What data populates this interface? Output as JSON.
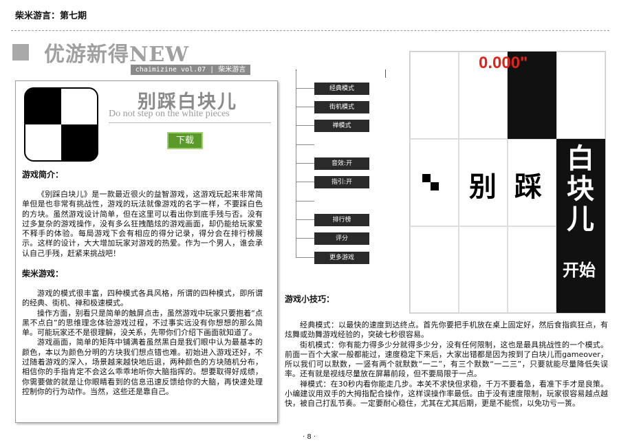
{
  "header": {
    "title": "柴米游言：第七期"
  },
  "section": {
    "title": "优游新得NEW",
    "tag": "chaimizine vol.07 | 柴米游言"
  },
  "game": {
    "name": "别踩白块儿",
    "name_en": "Do not step on the white pieces",
    "download_label": "下载"
  },
  "intro": {
    "heading": "游戏简介：",
    "paragraphs": [
      "《别踩白块儿》是一款最近很火的益智游戏，这游戏玩起来非常简单但是也非常有挑战性，游戏的玩法就像游戏的名字一样，不要踩白色的方块。虽然游戏设计简单，但在这里可以看出你到底手残与否。没有过多复杂的游戏操作，没有多么狂拽酷炫的游戏画面，却仍能给玩家爱不释手的体验。每局游戏下会有相应的得分记录，得分会在排行榜展示。这样的设计，大大增加玩家对游戏的热爱。作为一个男人，谁会承认自己手残，赶紧来挑战吧！"
    ]
  },
  "play": {
    "heading": "柴米游戏：",
    "paragraphs": [
      "游戏的模式很丰富，四种模式各具风格，所谓的四种模式，即所谓的经典、街机、禅和极速模式。",
      "操作方面，别看只是简单的触屏点击，虽然游戏中玩家只要抱着“点黑不点白”的思维理念体验游戏过程，不过事实远没有你想想的那么简单。可能玩家还不是很理解，没关系，先带你们介绍下画面就知道了。",
      "游戏画面，简单的矩阵中铺满着虽然黑白是我们眼中认为最基本的颜色，本以为颜色分明的方块我们想点错也难。初始进入游戏还好，不过随着游戏的深入，场景越来越快地后退，两种颜色的方块随机分布，相信你的手指肯定不会这么乖乖地听你大脑指挥的。想要取得好成绩，你需要做的就是让你眼睛看到的信息迅速反馈给你的大脑，再快速处理控制你的行为动作。当然，这些还是靠自己。"
    ]
  },
  "menu": {
    "items": [
      "经典模式",
      "街机模式",
      "禅模式",
      "音效:开",
      "指引:开",
      "排行榜",
      "评分",
      "更多游戏"
    ]
  },
  "screenshot": {
    "timer": "0.000\"",
    "title_chars": [
      "别",
      "踩"
    ],
    "title_vertical": "白块儿",
    "start_label": "开始"
  },
  "tips": {
    "heading": "游戏小技巧：",
    "paragraphs": [
      "经典模式：以最快的速度到达终点。首先你要把手机放在桌上固定好，然后食指疯狂点，有炫舞或劲舞游戏经验的，突破七秒很容易。",
      "街机模式：你有能力得多少分就得多少分，没有任何限制，这也是最具挑战性的一个模式。前面一百个大家一般都能过，速度稳定下来后，大家出错都是因为按到了白块儿而gameover，所以我们可以默数，一竖有两个就默数“一二”，有三个默数“一二三”，只要就能尽量降低失误率。还有就是视线尽量放在屏幕前段，但不要局限于一点。",
      "禅模式：在30秒内看你能走几步。本关不求快但求稳，千万不要着急，看准下手才是良策。小编建议用双手的大拇指配合操作，这样误操作率最低。由于没有速度限制，玩家很容易越点越快，被自己打乱节奏。一定要耐心稳住，尤其在尤其后期，更是不能慌，以免功亏一篑。"
    ]
  },
  "footer": {
    "page": "· 8 ·"
  },
  "colors": {
    "accent_green": "#5a9a2a",
    "timer_red": "#e0231b",
    "section_gray": "#a0a0a0"
  }
}
